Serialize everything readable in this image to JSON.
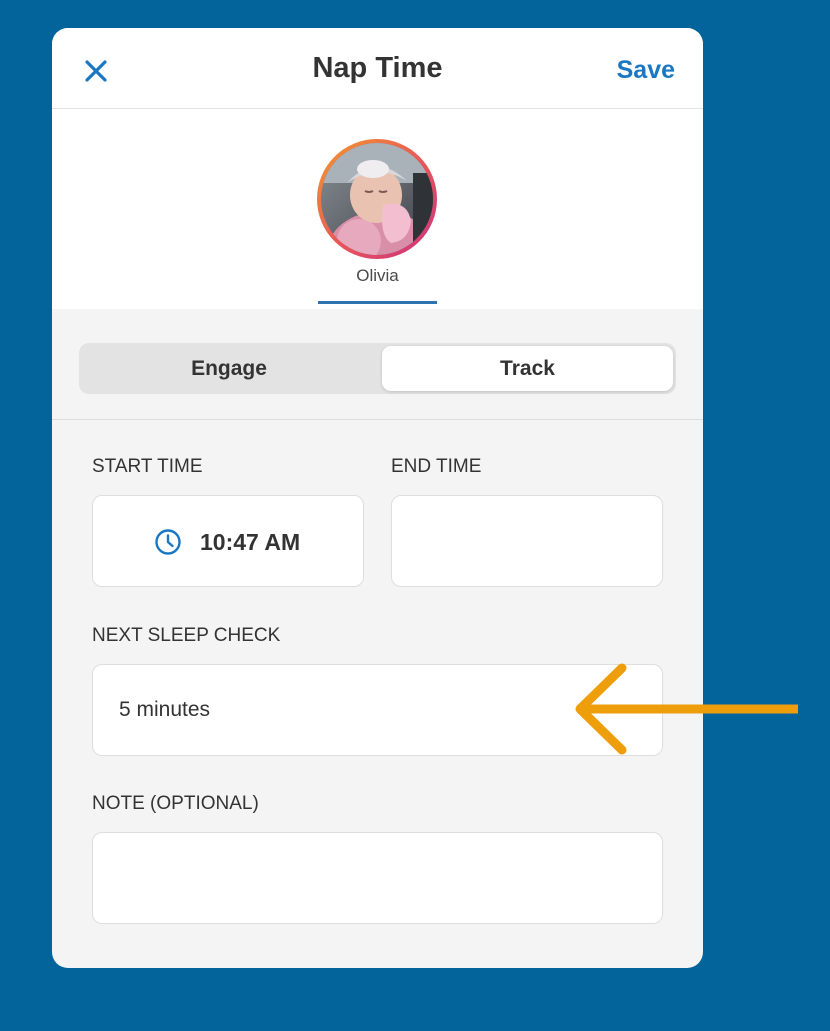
{
  "header": {
    "title": "Nap Time",
    "save_label": "Save"
  },
  "child": {
    "name": "Olivia"
  },
  "tabs": [
    {
      "label": "Engage",
      "selected": false
    },
    {
      "label": "Track",
      "selected": true
    }
  ],
  "form": {
    "start_time": {
      "label": "START TIME",
      "value": "10:47 AM"
    },
    "end_time": {
      "label": "END TIME",
      "value": ""
    },
    "next_sleep_check": {
      "label": "NEXT SLEEP CHECK",
      "value": "5 minutes"
    },
    "note": {
      "label": "NOTE (OPTIONAL)",
      "value": ""
    }
  },
  "icons": {
    "close": "close-icon",
    "clock": "clock-icon",
    "arrow": "arrow-left-icon"
  },
  "colors": {
    "background": "#03649c",
    "accent": "#1a78c2",
    "arrow": "#ee9d0b",
    "card": "#f4f4f4"
  }
}
